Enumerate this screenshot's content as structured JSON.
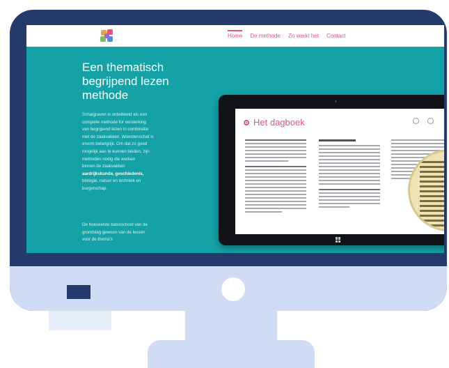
{
  "nav": {
    "links": [
      "Home",
      "De methode",
      "Zo werkt het",
      "Contact"
    ],
    "active_index": 0
  },
  "hero": {
    "title": "Een thematisch begrijpend lezen methode",
    "body_lines": [
      "Schatgraven is ontwikkeld als een",
      "complete methode for versterking",
      "van begrijpend lezen in combinatie",
      "met de zaakvakken. Woordenschat is",
      "enorm belangrijk. Om dat zo goed",
      "mogelijk aan te kunnen bieden, zijn",
      "methoden nodig die werken",
      "binnen de zaakvakken"
    ],
    "body_highlight": "aardrijkskunde, geschiedenis,",
    "body_tail": [
      "biologie, natuur en techniek en",
      "burgerschap."
    ],
    "foot_lines": [
      "De hoeveelste basisschool van de",
      "grondslag gewoon van de lessen",
      "voor de thema's"
    ]
  },
  "tablet": {
    "book_title": "Het dagboek"
  },
  "colors": {
    "teal": "#14a2a7",
    "accent": "#e8547a",
    "bezel": "#233a6b",
    "stand": "#cfdcf3"
  }
}
